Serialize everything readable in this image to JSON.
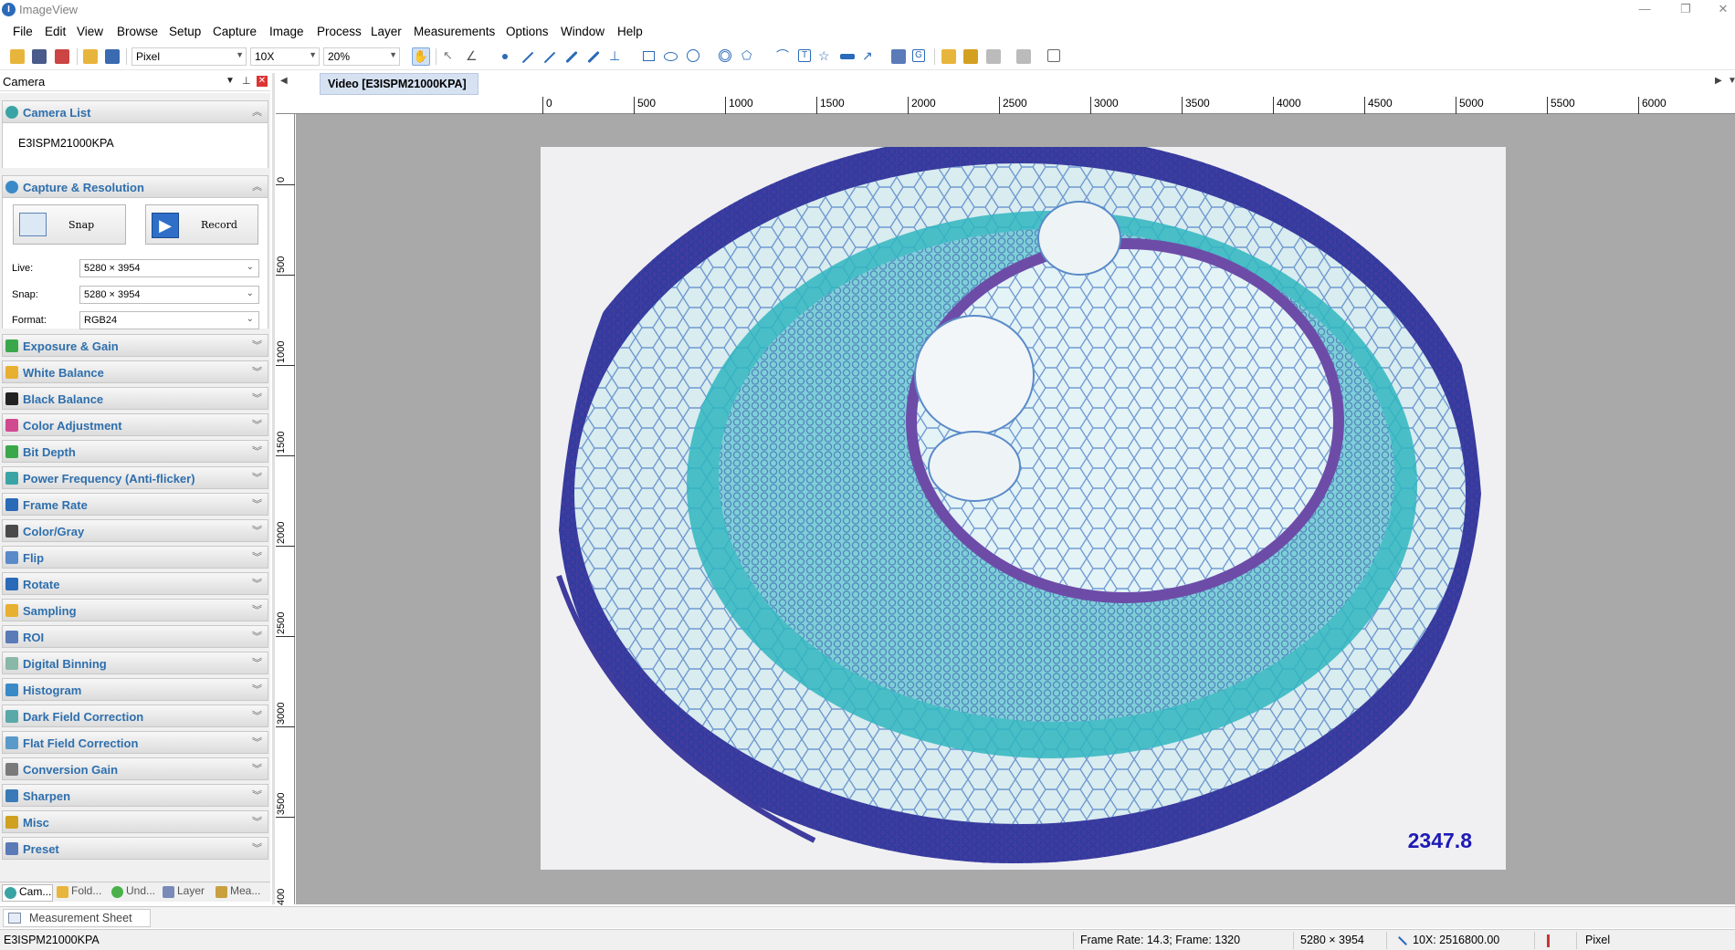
{
  "window": {
    "app_icon": "imageview-logo-icon",
    "title": "ImageView",
    "minimize": "—",
    "restore": "❐",
    "close": "✕"
  },
  "menu": [
    "File",
    "Edit",
    "View",
    "Browse",
    "Setup",
    "Capture",
    "Image",
    "Process",
    "Layer",
    "Measurements",
    "Options",
    "Window",
    "Help"
  ],
  "toolbar": {
    "unit": "Pixel",
    "magnification": "10X",
    "zoom": "20%"
  },
  "panel": {
    "title": "Camera",
    "camera_list": {
      "title": "Camera List",
      "device": "E3ISPM21000KPA"
    },
    "capture": {
      "title": "Capture & Resolution",
      "snap": "Snap",
      "record": "Record",
      "live_label": "Live:",
      "live_value": "5280 × 3954",
      "snap_label": "Snap:",
      "snap_value": "5280 × 3954",
      "format_label": "Format:",
      "format_value": "RGB24"
    },
    "sections": [
      "Exposure & Gain",
      "White Balance",
      "Black Balance",
      "Color Adjustment",
      "Bit Depth",
      "Power Frequency (Anti-flicker)",
      "Frame Rate",
      "Color/Gray",
      "Flip",
      "Rotate",
      "Sampling",
      "ROI",
      "Digital Binning",
      "Histogram",
      "Dark Field Correction",
      "Flat Field Correction",
      "Conversion Gain",
      "Sharpen",
      "Misc",
      "Preset"
    ],
    "tabs": [
      "Cam...",
      "Fold...",
      "Und...",
      "Layer",
      "Mea..."
    ]
  },
  "document": {
    "tab": "Video [E3ISPM21000KPA]",
    "ruler_top": [
      "0",
      "500",
      "1000",
      "1500",
      "2000",
      "2500",
      "3000",
      "3500",
      "4000",
      "4500",
      "5000",
      "5500",
      "6000"
    ],
    "ruler_left": [
      "0",
      "500",
      "1000",
      "1500",
      "2000",
      "2500",
      "3000",
      "3500",
      "400"
    ],
    "scale_value": "2347.8"
  },
  "measurement_sheet": "Measurement Sheet",
  "status": {
    "device": "E3ISPM21000KPA",
    "frame_info": "Frame Rate: 14.3; Frame: 1320",
    "resolution": "5280 × 3954",
    "calibration": "10X: 2516800.00",
    "unit": "Pixel"
  }
}
